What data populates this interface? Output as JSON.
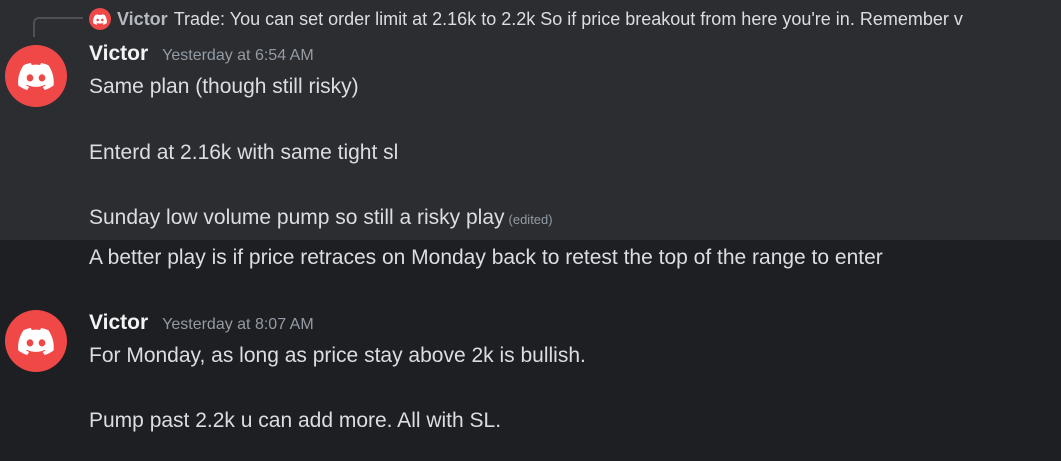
{
  "reply": {
    "author": "Victor",
    "text": "Trade:  You can set order limit at 2.16k to 2.2k  So if price breakout from here you're in.  Remember v"
  },
  "messages": [
    {
      "author": "Victor",
      "timestamp": "Yesterday at 6:54 AM",
      "avatar_icon": "discord-logo-icon",
      "lines": [
        "Same plan (though still risky)",
        "Enterd at 2.16k with same tight sl",
        "Sunday low volume pump so still a risky play",
        "A better play is if price retraces on Monday back to retest the top of the range to enter"
      ],
      "edited_label": "(edited)"
    },
    {
      "author": "Victor",
      "timestamp": "Yesterday at 8:07 AM",
      "avatar_icon": "discord-logo-icon",
      "lines": [
        "For Monday, as long as price stay above 2k is bullish.",
        "Pump past 2.2k u can add more. All with SL."
      ]
    }
  ],
  "colors": {
    "background": "#1e1f22",
    "hover_background": "#2b2d31",
    "avatar": "#f04747",
    "text": "#dbdee1",
    "muted": "#949ba4"
  }
}
